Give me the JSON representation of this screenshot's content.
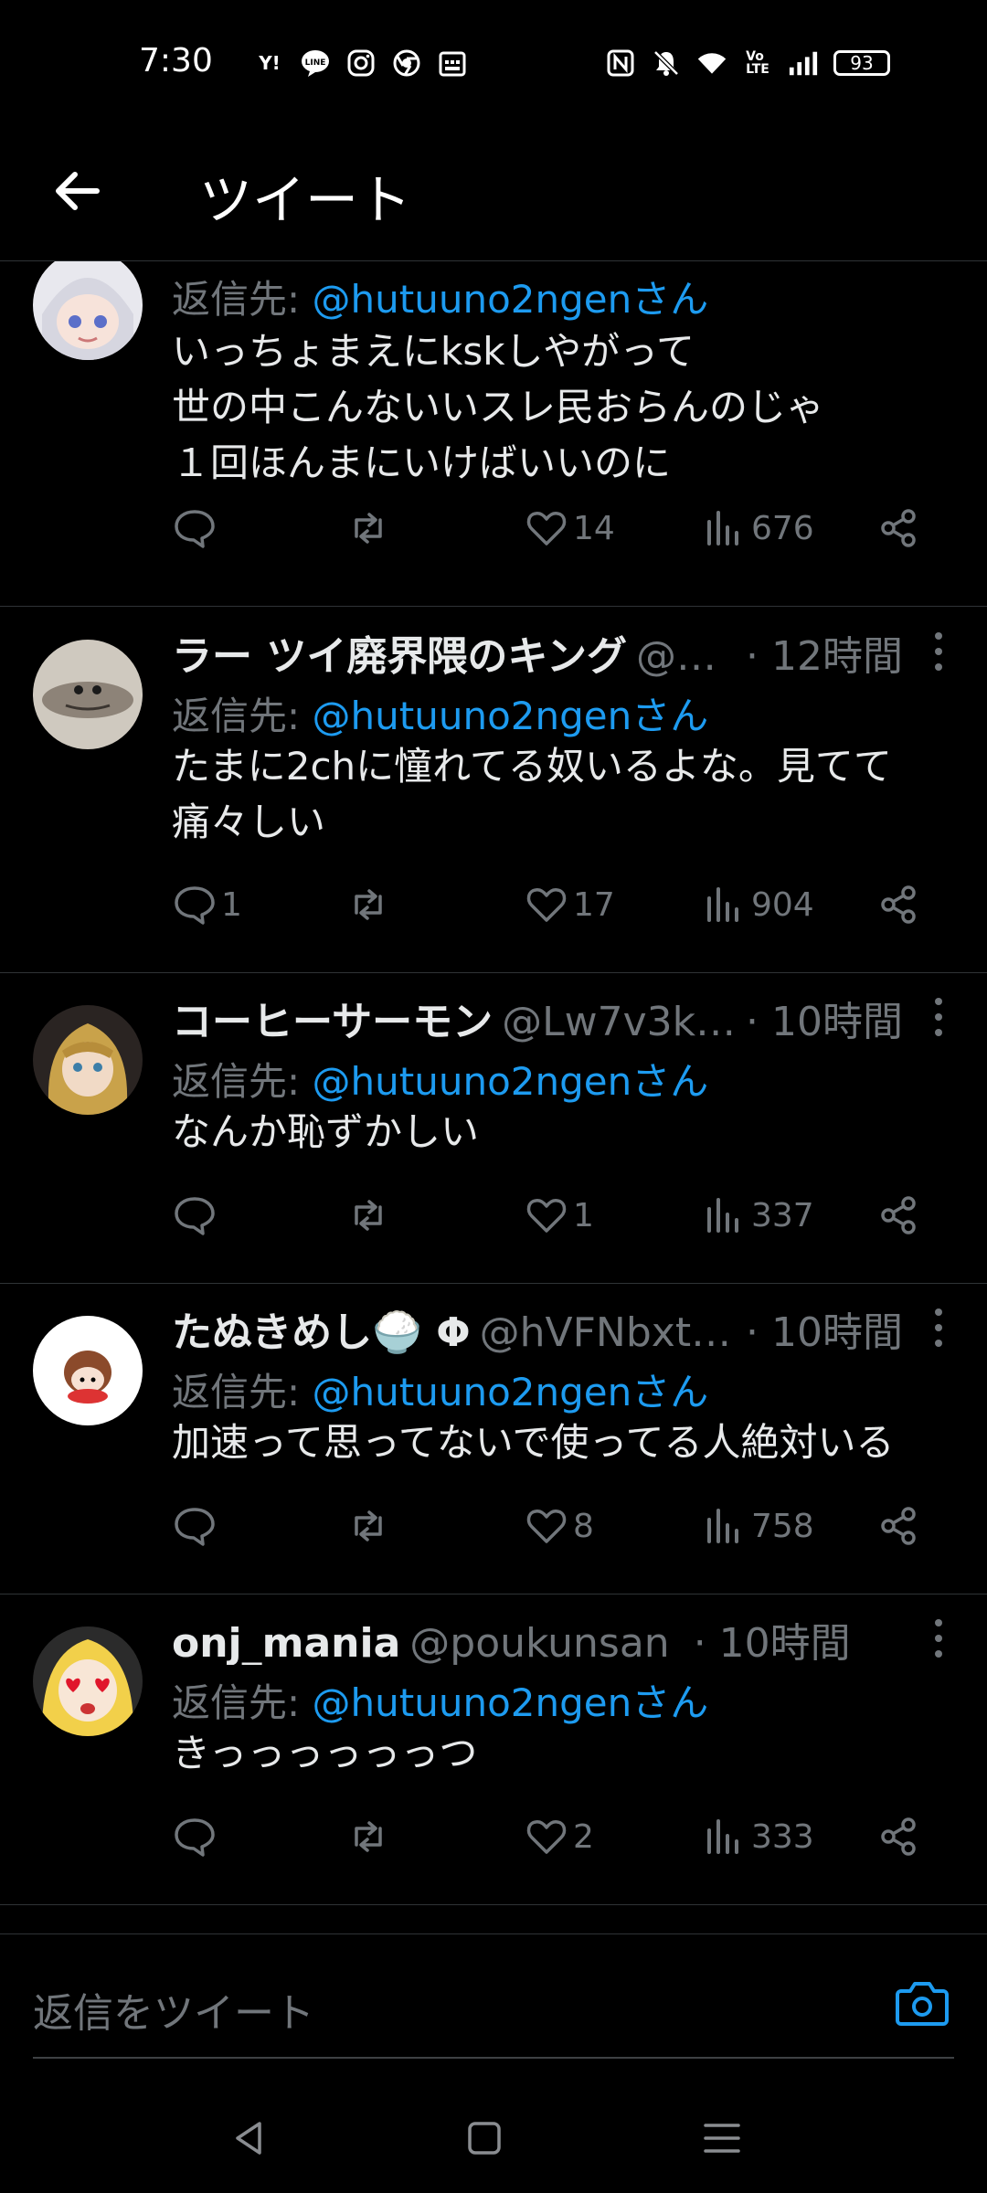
{
  "status_bar": {
    "time": "7:30",
    "left_icons": [
      "yahoo-icon",
      "line-icon",
      "instagram-icon",
      "chrome-icon",
      "calendar-icon"
    ],
    "right_icons": [
      "nfc-icon",
      "mute-icon",
      "wifi-icon",
      "volte-icon",
      "signal-icon"
    ],
    "battery": "93"
  },
  "header": {
    "title": "ツイート"
  },
  "tweets": [
    {
      "name": "",
      "handle": "",
      "time": "",
      "reply_prefix": "返信先: ",
      "reply_to": "@hutuuno2ngenさん",
      "text": [
        "いっちょまえにkskしやがって",
        "世の中こんないいスレ民おらんのじゃ",
        "１回ほんまにいけばいいのに"
      ],
      "replies": "",
      "likes": "14",
      "views": "676"
    },
    {
      "name": "ラー ツイ廃界隈のキング",
      "handle": "@…",
      "time": "· 12時間",
      "reply_prefix": "返信先: ",
      "reply_to": "@hutuuno2ngenさん",
      "text": [
        "たまに2chに憧れてる奴いるよな。見てて",
        "痛々しい"
      ],
      "replies": "1",
      "likes": "17",
      "views": "904"
    },
    {
      "name": "コーヒーサーモン",
      "handle": "@Lw7v3k…",
      "time": "· 10時間",
      "reply_prefix": "返信先: ",
      "reply_to": "@hutuuno2ngenさん",
      "text": [
        "なんか恥ずかしい"
      ],
      "replies": "",
      "likes": "1",
      "views": "337"
    },
    {
      "name": "たぬきめし🍚 Φ",
      "handle": "@hVFNbxt…",
      "time": "· 10時間",
      "reply_prefix": "返信先: ",
      "reply_to": "@hutuuno2ngenさん",
      "text": [
        "加速って思ってないで使ってる人絶対いる"
      ],
      "replies": "",
      "likes": "8",
      "views": "758"
    },
    {
      "name": "onj_mania",
      "handle": "@poukunsan",
      "time": "· 10時間",
      "reply_prefix": "返信先: ",
      "reply_to": "@hutuuno2ngenさん",
      "text": [
        "きっっっっっっつ"
      ],
      "replies": "",
      "likes": "2",
      "views": "333"
    }
  ],
  "reply_bar": {
    "placeholder": "返信をツイート"
  },
  "colors": {
    "accent": "#1d9bf0",
    "muted": "#71767b",
    "text": "#e7e9ea",
    "background": "#000000"
  }
}
